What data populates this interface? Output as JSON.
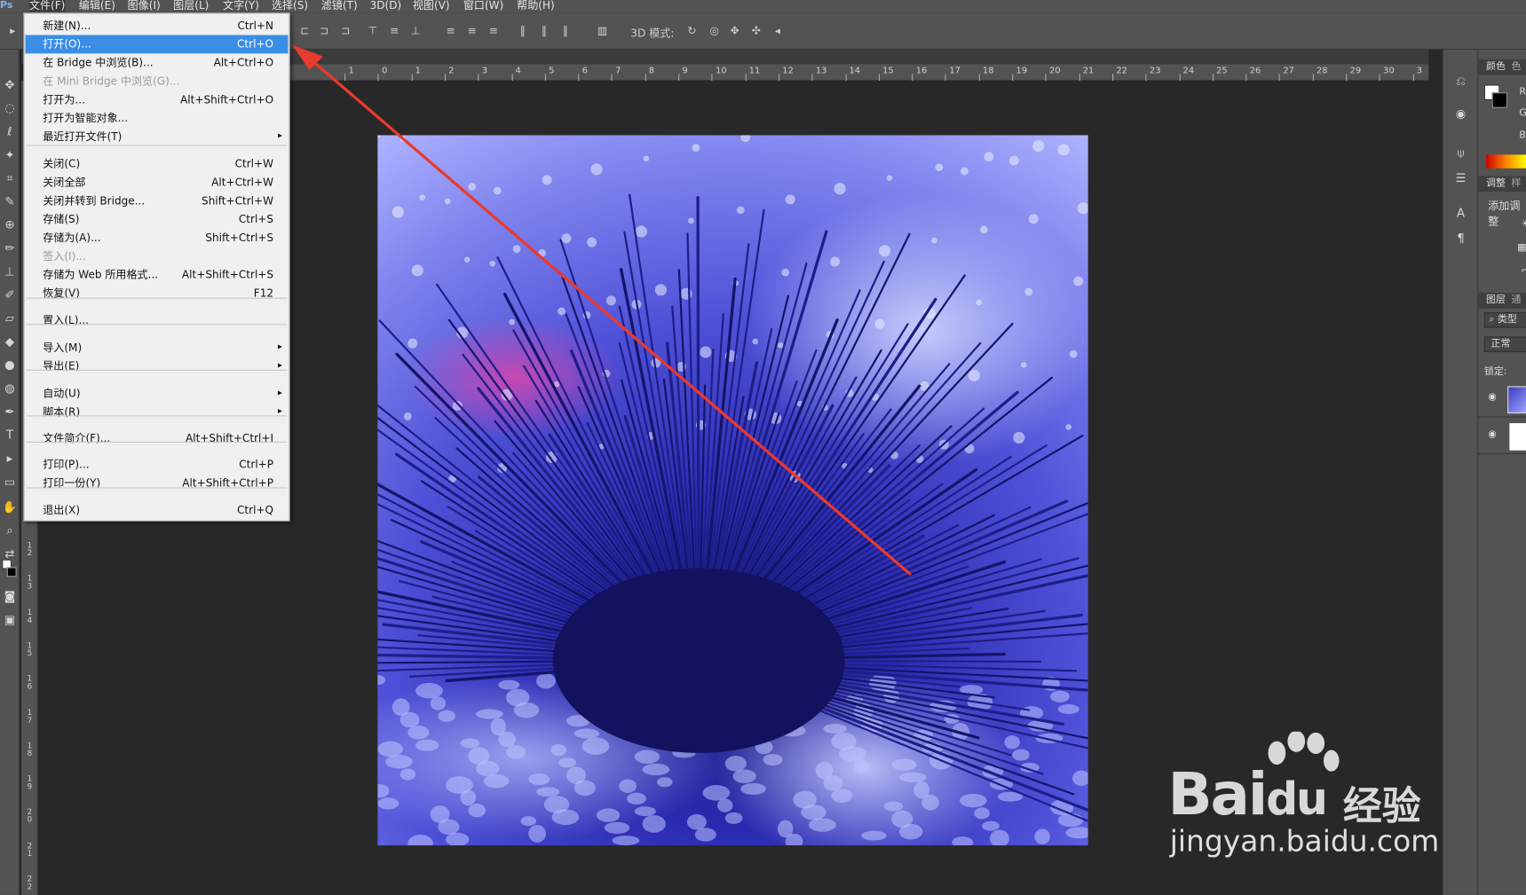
{
  "app": {
    "logo": "Ps"
  },
  "menubar": {
    "items": [
      "文件(F)",
      "编辑(E)",
      "图像(I)",
      "图层(L)",
      "文字(Y)",
      "选择(S)",
      "滤镜(T)",
      "3D(D)",
      "视图(V)",
      "窗口(W)",
      "帮助(H)"
    ],
    "active": "文件(F)"
  },
  "options_bar": {
    "mode_3d_label": "3D 模式:"
  },
  "document_tab": {
    "close": "×"
  },
  "ruler": {
    "h_ticks": [
      "1",
      "0",
      "1",
      "2",
      "3",
      "4",
      "5",
      "6",
      "7",
      "8",
      "9",
      "10",
      "11",
      "12",
      "13",
      "14",
      "15",
      "16",
      "17",
      "18",
      "19",
      "20",
      "21",
      "22",
      "23",
      "24",
      "25",
      "26",
      "27",
      "28",
      "29",
      "30",
      "3"
    ],
    "v_ticks": [
      "1\n2",
      "1\n3",
      "1\n4",
      "1\n5",
      "1\n6",
      "1\n7",
      "1\n8",
      "1\n9",
      "2\n0",
      "2\n1",
      "2\n2"
    ]
  },
  "file_menu": {
    "items": [
      {
        "label": "新建(N)...",
        "shortcut": "Ctrl+N"
      },
      {
        "label": "打开(O)...",
        "shortcut": "Ctrl+O",
        "highlighted": true
      },
      {
        "label": "在 Bridge 中浏览(B)...",
        "shortcut": "Alt+Ctrl+O"
      },
      {
        "label": "在 Mini Bridge 中浏览(G)...",
        "shortcut": "",
        "disabled": true
      },
      {
        "label": "打开为...",
        "shortcut": "Alt+Shift+Ctrl+O"
      },
      {
        "label": "打开为智能对象...",
        "shortcut": ""
      },
      {
        "label": "最近打开文件(T)",
        "shortcut": "",
        "submenu": true
      },
      {
        "label": "关闭(C)",
        "shortcut": "Ctrl+W"
      },
      {
        "label": "关闭全部",
        "shortcut": "Alt+Ctrl+W"
      },
      {
        "label": "关闭并转到 Bridge...",
        "shortcut": "Shift+Ctrl+W"
      },
      {
        "label": "存储(S)",
        "shortcut": "Ctrl+S"
      },
      {
        "label": "存储为(A)...",
        "shortcut": "Shift+Ctrl+S"
      },
      {
        "label": "签入(I)...",
        "shortcut": "",
        "disabled": true
      },
      {
        "label": "存储为 Web 所用格式...",
        "shortcut": "Alt+Shift+Ctrl+S"
      },
      {
        "label": "恢复(V)",
        "shortcut": "F12"
      },
      {
        "label": "置入(L)...",
        "shortcut": ""
      },
      {
        "label": "导入(M)",
        "shortcut": "",
        "submenu": true
      },
      {
        "label": "导出(E)",
        "shortcut": "",
        "submenu": true
      },
      {
        "label": "自动(U)",
        "shortcut": "",
        "submenu": true
      },
      {
        "label": "脚本(R)",
        "shortcut": "",
        "submenu": true
      },
      {
        "label": "文件简介(F)...",
        "shortcut": "Alt+Shift+Ctrl+I"
      },
      {
        "label": "打印(P)...",
        "shortcut": "Ctrl+P"
      },
      {
        "label": "打印一份(Y)",
        "shortcut": "Alt+Shift+Ctrl+P"
      },
      {
        "label": "退出(X)",
        "shortcut": "Ctrl+Q"
      }
    ],
    "submenu_glyph": "▸"
  },
  "right_panel": {
    "color_tab": "颜色",
    "color_tab2": "色",
    "channels": [
      "R",
      "G",
      "B"
    ],
    "adjust_tab": "调整",
    "adjust_tab2": "样",
    "adjust_add": "添加调整",
    "layers_tab": "图层",
    "layers_tab2": "通",
    "layers_kind": "类型",
    "blend_mode": "正常",
    "lock_label": "锁定:"
  },
  "watermark": {
    "brand": "Bai",
    "brand2": "du",
    "cn": "经验",
    "url": "jingyan.baidu.com"
  },
  "colors": {
    "ui_bg": "#535353",
    "workspace": "#282828",
    "menu_highlight": "#3a8ee6",
    "arrow": "#e83a2e"
  }
}
